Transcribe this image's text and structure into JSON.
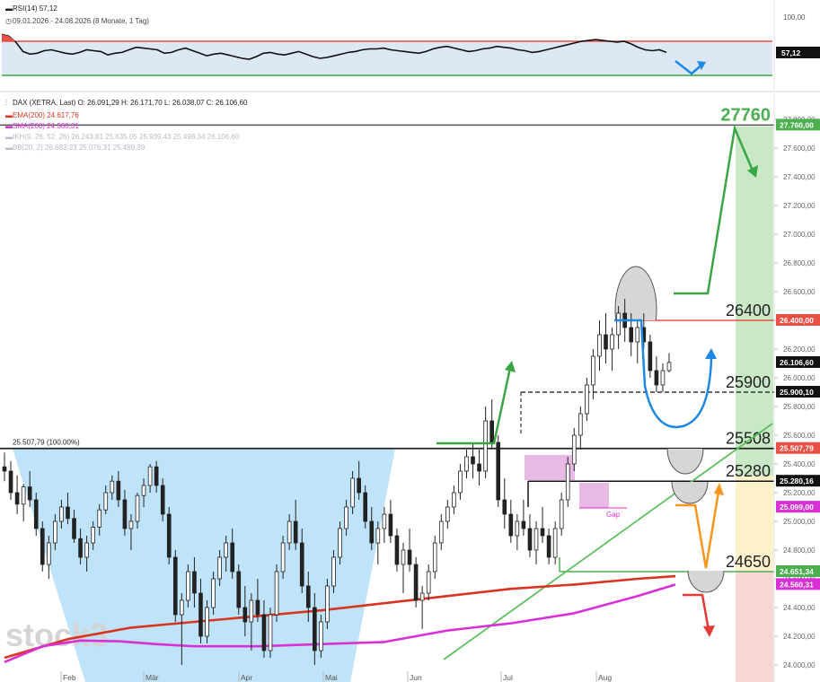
{
  "rsi_panel": {
    "title": "RSI(14) 57,12",
    "range_label": "09.01.2026 - 24.08.2026 (8 Monate, 1 Tag)",
    "value_tag": "57,12",
    "axis_label_top": "100,00",
    "upper_level": 70,
    "lower_level": 30,
    "ylim": [
      0,
      100
    ],
    "values": [
      78,
      76,
      69,
      58,
      55,
      56,
      59,
      60,
      58,
      56,
      55,
      57,
      60,
      59,
      58,
      54,
      56,
      57,
      60,
      63,
      62,
      61,
      60,
      56,
      57,
      60,
      62,
      59,
      56,
      53,
      55,
      56,
      54,
      52,
      50,
      49,
      52,
      56,
      57,
      55,
      54,
      56,
      58,
      55,
      52,
      50,
      51,
      53,
      55,
      57,
      58,
      60,
      61,
      61,
      62,
      60,
      59,
      58,
      57,
      56,
      58,
      61,
      63,
      64,
      62,
      60,
      58,
      59,
      61,
      62,
      64,
      63,
      62,
      60,
      59,
      57,
      58,
      60,
      62,
      64,
      66,
      68,
      70,
      71,
      72,
      71,
      70,
      69,
      70,
      67,
      63,
      60,
      59,
      60,
      57
    ]
  },
  "header": {
    "title": "DAX (XETRA, Last)  O: 26.091,29  H: 26.171,70  L: 26.038,07  C: 26.106,60",
    "ema_label": "EMA(200)  24.617,76",
    "sma_label": "SMA(200)  24.560,31",
    "ikh_label": "IKH(9, 26, 52, 26)  26.243,81  25.635,05  25.939,43  25.498,34  26.106,60",
    "bb_label": "BB(20, 2)  26.683,23  25.076,31  25.489,39",
    "colors": {
      "ema": "#d9341f",
      "sma": "#d82fd6",
      "muted": "#b9b9c9"
    }
  },
  "price_axis": {
    "ticks": [
      "27.800,00",
      "27.600,00",
      "27.400,00",
      "27.200,00",
      "27.000,00",
      "26.800,00",
      "26.600,00",
      "26.400,00",
      "26.200,00",
      "26.000,00",
      "25.800,00",
      "25.600,00",
      "25.400,00",
      "25.200,00",
      "25.000,00",
      "24.800,00",
      "24.600,00",
      "24.400,00",
      "24.200,00",
      "24.000,00"
    ]
  },
  "month_labels": [
    "Feb",
    "Mär",
    "Apr",
    "Mai",
    "Jun",
    "Jul",
    "Aug"
  ],
  "watermark": "stock3",
  "gap_label": "Gap",
  "fib_label": "25.507,79 (100.00%)",
  "levels": [
    {
      "text": "27760",
      "value": 27760,
      "tag": "27.760,00",
      "line_color": "#555555",
      "text_color": "#4caf50",
      "tag_bg": "#4caf50"
    },
    {
      "text": "26400",
      "value": 26400,
      "tag": "26.400,00",
      "line_color": "#e84f45",
      "text_color": "#222222",
      "tag_bg": "#e84f45"
    },
    {
      "text": "25900",
      "value": 25900,
      "tag": "25.900,10",
      "line_color": "#333333",
      "text_color": "#222222",
      "tag_bg": "#111111"
    },
    {
      "text": "25508",
      "value": 25508,
      "tag": "25.507,79",
      "line_color": "#222222",
      "text_color": "#222222",
      "tag_bg": "#e84f45"
    },
    {
      "text": "25280",
      "value": 25280,
      "tag": "25.280,16",
      "line_color": "#111111",
      "text_color": "#222222",
      "tag_bg": "#111111"
    },
    {
      "text": "24650",
      "value": 24650,
      "tag": "24.651,34",
      "line_color": "#4caf50",
      "text_color": "#222222",
      "tag_bg": "#4caf50"
    }
  ],
  "extra_tags": [
    {
      "tag": "26.106,60",
      "value": 26106.6,
      "bg": "#111111"
    },
    {
      "tag": "25.099,00",
      "value": 25099,
      "bg": "#d82fd6"
    },
    {
      "tag": "24.560,31",
      "value": 24560.31,
      "bg": "#d82fd6"
    }
  ],
  "chart_data": {
    "type": "candlestick",
    "title": "DAX (XETRA, Last)",
    "ylim": [
      23950,
      27850
    ],
    "x_months": [
      "Feb",
      "Mär",
      "Apr",
      "Mai",
      "Jun",
      "Jul",
      "Aug"
    ],
    "ohlc": [
      [
        25380,
        25480,
        25280,
        25350
      ],
      [
        25350,
        25420,
        25150,
        25200
      ],
      [
        25200,
        25320,
        25050,
        25120
      ],
      [
        25120,
        25260,
        25000,
        25240
      ],
      [
        25240,
        25350,
        25100,
        25150
      ],
      [
        25150,
        25200,
        24900,
        24950
      ],
      [
        24950,
        25000,
        24650,
        24700
      ],
      [
        24700,
        24900,
        24600,
        24850
      ],
      [
        24850,
        25050,
        24800,
        25000
      ],
      [
        25000,
        25150,
        24950,
        25100
      ],
      [
        25100,
        25200,
        24980,
        25020
      ],
      [
        25020,
        25080,
        24850,
        24880
      ],
      [
        24880,
        24950,
        24700,
        24750
      ],
      [
        24750,
        24900,
        24650,
        24850
      ],
      [
        24850,
        25000,
        24800,
        24960
      ],
      [
        24960,
        25120,
        24900,
        25080
      ],
      [
        25080,
        25250,
        25050,
        25200
      ],
      [
        25200,
        25320,
        25150,
        25280
      ],
      [
        25280,
        25350,
        25100,
        25150
      ],
      [
        25150,
        25220,
        24900,
        24950
      ],
      [
        24950,
        25050,
        24800,
        25000
      ],
      [
        25000,
        25200,
        24950,
        25180
      ],
      [
        25180,
        25300,
        25100,
        25250
      ],
      [
        25250,
        25400,
        25200,
        25380
      ],
      [
        25380,
        25420,
        25200,
        25250
      ],
      [
        25250,
        25300,
        25000,
        25050
      ],
      [
        25050,
        25100,
        24700,
        24750
      ],
      [
        24750,
        24800,
        24300,
        24350
      ],
      [
        24350,
        24500,
        24000,
        24450
      ],
      [
        24450,
        24700,
        24400,
        24650
      ],
      [
        24650,
        24750,
        24400,
        24500
      ],
      [
        24500,
        24600,
        24150,
        24200
      ],
      [
        24200,
        24450,
        24150,
        24400
      ],
      [
        24400,
        24650,
        24350,
        24600
      ],
      [
        24600,
        24800,
        24550,
        24750
      ],
      [
        24750,
        24900,
        24650,
        24850
      ],
      [
        24850,
        24950,
        24600,
        24650
      ],
      [
        24650,
        24700,
        24350,
        24400
      ],
      [
        24400,
        24550,
        24200,
        24300
      ],
      [
        24300,
        24500,
        24100,
        24450
      ],
      [
        24450,
        24600,
        24300,
        24350
      ],
      [
        24350,
        24450,
        24050,
        24100
      ],
      [
        24100,
        24400,
        24050,
        24350
      ],
      [
        24350,
        24700,
        24300,
        24650
      ],
      [
        24650,
        24900,
        24600,
        24850
      ],
      [
        24850,
        25050,
        24800,
        25000
      ],
      [
        25000,
        25150,
        24800,
        24850
      ],
      [
        24850,
        24950,
        24500,
        24550
      ],
      [
        24550,
        24650,
        24300,
        24400
      ],
      [
        24400,
        24500,
        24000,
        24100
      ],
      [
        24100,
        24350,
        24050,
        24300
      ],
      [
        24300,
        24600,
        24250,
        24550
      ],
      [
        24550,
        24800,
        24500,
        24750
      ],
      [
        24750,
        25000,
        24700,
        24950
      ],
      [
        24950,
        25150,
        24900,
        25100
      ],
      [
        25100,
        25350,
        25050,
        25300
      ],
      [
        25300,
        25420,
        25150,
        25200
      ],
      [
        25200,
        25250,
        24950,
        25000
      ],
      [
        25000,
        25100,
        24800,
        24850
      ],
      [
        24850,
        25000,
        24700,
        24950
      ],
      [
        24950,
        25100,
        24850,
        25050
      ],
      [
        25050,
        25150,
        24850,
        24900
      ],
      [
        24900,
        24950,
        24650,
        24700
      ],
      [
        24700,
        24850,
        24500,
        24800
      ],
      [
        24800,
        24950,
        24650,
        24700
      ],
      [
        24700,
        24750,
        24400,
        24450
      ],
      [
        24450,
        24550,
        24250,
        24500
      ],
      [
        24500,
        24700,
        24450,
        24650
      ],
      [
        24650,
        24900,
        24600,
        24850
      ],
      [
        24850,
        25050,
        24800,
        25000
      ],
      [
        25000,
        25150,
        24950,
        25100
      ],
      [
        25100,
        25250,
        25050,
        25200
      ],
      [
        25200,
        25400,
        25150,
        25350
      ],
      [
        25350,
        25500,
        25300,
        25450
      ],
      [
        25450,
        25550,
        25300,
        25400
      ],
      [
        25400,
        25500,
        25250,
        25350
      ],
      [
        25350,
        25800,
        25300,
        25700
      ],
      [
        25700,
        25850,
        25500,
        25550
      ],
      [
        25550,
        25600,
        25100,
        25150
      ],
      [
        25150,
        25300,
        24950,
        25050
      ],
      [
        25050,
        25150,
        24850,
        24900
      ],
      [
        24900,
        25050,
        24800,
        25000
      ],
      [
        25000,
        25150,
        24900,
        24950
      ],
      [
        24950,
        25050,
        24750,
        24800
      ],
      [
        24800,
        25000,
        24700,
        24950
      ],
      [
        24950,
        25100,
        24850,
        24900
      ],
      [
        24900,
        24950,
        24700,
        24750
      ],
      [
        24750,
        25000,
        24700,
        24950
      ],
      [
        24950,
        25200,
        24900,
        25150
      ],
      [
        25150,
        25450,
        25100,
        25400
      ],
      [
        25400,
        25650,
        25350,
        25600
      ],
      [
        25600,
        25800,
        25500,
        25750
      ],
      [
        25750,
        26000,
        25700,
        25950
      ],
      [
        25950,
        26200,
        25850,
        26150
      ],
      [
        26150,
        26400,
        26050,
        26300
      ],
      [
        26300,
        26450,
        26100,
        26200
      ],
      [
        26200,
        26350,
        26050,
        26300
      ],
      [
        26300,
        26500,
        26200,
        26450
      ],
      [
        26450,
        26550,
        26250,
        26350
      ],
      [
        26350,
        26450,
        26150,
        26250
      ],
      [
        26250,
        26400,
        26100,
        26350
      ],
      [
        26350,
        26450,
        26200,
        26250
      ],
      [
        26250,
        26300,
        26000,
        26050
      ],
      [
        26050,
        26150,
        25900,
        25950
      ],
      [
        25950,
        26100,
        25900,
        26050
      ],
      [
        26050,
        26172,
        26038,
        26107
      ]
    ],
    "ema200": [
      [
        0,
        24050
      ],
      [
        10,
        24180
      ],
      [
        20,
        24260
      ],
      [
        30,
        24300
      ],
      [
        40,
        24340
      ],
      [
        50,
        24380
      ],
      [
        60,
        24430
      ],
      [
        70,
        24480
      ],
      [
        80,
        24530
      ],
      [
        90,
        24560
      ],
      [
        100,
        24600
      ],
      [
        106,
        24618
      ]
    ],
    "sma200": [
      [
        0,
        24020
      ],
      [
        6,
        24130
      ],
      [
        12,
        24170
      ],
      [
        18,
        24165
      ],
      [
        24,
        24145
      ],
      [
        30,
        24130
      ],
      [
        40,
        24130
      ],
      [
        50,
        24145
      ],
      [
        60,
        24160
      ],
      [
        70,
        24240
      ],
      [
        80,
        24290
      ],
      [
        90,
        24360
      ],
      [
        100,
        24480
      ],
      [
        106,
        24560
      ]
    ]
  }
}
